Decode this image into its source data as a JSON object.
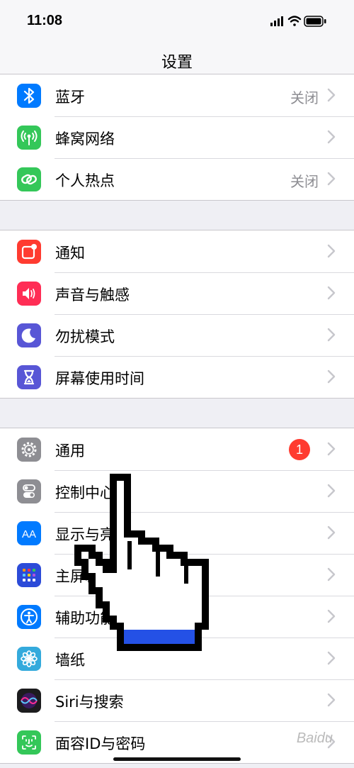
{
  "status_bar": {
    "time": "11:08"
  },
  "nav": {
    "title": "设置"
  },
  "groups": [
    {
      "rows": [
        {
          "label": "蓝牙",
          "value": "关闭",
          "icon": "bluetooth-icon",
          "color": "#007aff"
        },
        {
          "label": "蜂窝网络",
          "value": "",
          "icon": "cellular-antenna-icon",
          "color": "#34c759"
        },
        {
          "label": "个人热点",
          "value": "关闭",
          "icon": "hotspot-link-icon",
          "color": "#34c759"
        }
      ]
    },
    {
      "rows": [
        {
          "label": "通知",
          "icon": "notifications-icon",
          "color": "#ff3b30"
        },
        {
          "label": "声音与触感",
          "icon": "speaker-icon",
          "color": "#ff2d55"
        },
        {
          "label": "勿扰模式",
          "icon": "moon-icon",
          "color": "#5856d6"
        },
        {
          "label": "屏幕使用时间",
          "icon": "hourglass-icon",
          "color": "#5856d6"
        }
      ]
    },
    {
      "rows": [
        {
          "label": "通用",
          "badge": "1",
          "icon": "gear-icon",
          "color": "#8e8e93"
        },
        {
          "label": "控制中心",
          "icon": "toggles-icon",
          "color": "#8e8e93"
        },
        {
          "label": "显示与亮度",
          "icon": "text-size-icon",
          "color": "#007aff"
        },
        {
          "label": "主屏幕",
          "icon": "home-grid-icon",
          "color": "#2c4bd8"
        },
        {
          "label": "辅助功能",
          "icon": "accessibility-icon",
          "color": "#007aff"
        },
        {
          "label": "墙纸",
          "icon": "flower-icon",
          "color": "#34aadc"
        },
        {
          "label": "Siri与搜索",
          "icon": "siri-icon",
          "color": "#1c1c1e"
        },
        {
          "label": "面容ID与密码",
          "icon": "face-id-icon",
          "color": "#34c759"
        }
      ]
    }
  ],
  "watermark": "Baidu"
}
